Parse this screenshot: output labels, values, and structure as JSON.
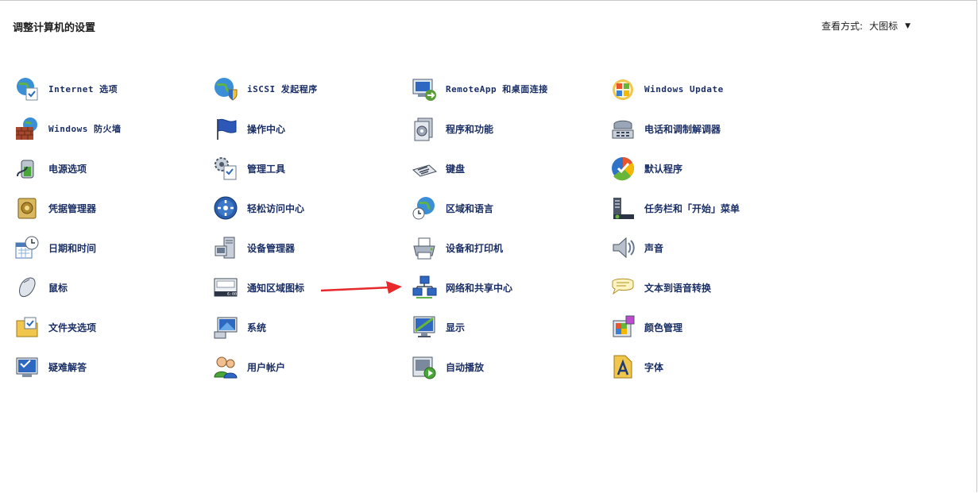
{
  "header": {
    "title": "调整计算机的设置",
    "view_label": "查看方式:",
    "view_value": "大图标"
  },
  "items": [
    {
      "label": "Internet 选项",
      "icon": "globe-check-icon"
    },
    {
      "label": "iSCSI 发起程序",
      "icon": "globe-shield-icon"
    },
    {
      "label": "RemoteApp 和桌面连接",
      "icon": "remote-desktop-icon"
    },
    {
      "label": "Windows Update",
      "icon": "windows-update-icon"
    },
    {
      "label": "Windows 防火墙",
      "icon": "firewall-icon"
    },
    {
      "label": "操作中心",
      "icon": "flag-icon"
    },
    {
      "label": "程序和功能",
      "icon": "programs-icon"
    },
    {
      "label": "电话和调制解调器",
      "icon": "phone-icon"
    },
    {
      "label": "电源选项",
      "icon": "battery-icon"
    },
    {
      "label": "管理工具",
      "icon": "admin-tools-icon"
    },
    {
      "label": "键盘",
      "icon": "keyboard-icon"
    },
    {
      "label": "默认程序",
      "icon": "default-programs-icon"
    },
    {
      "label": "凭据管理器",
      "icon": "vault-icon"
    },
    {
      "label": "轻松访问中心",
      "icon": "accessibility-icon"
    },
    {
      "label": "区域和语言",
      "icon": "globe-clock-icon"
    },
    {
      "label": "任务栏和「开始」菜单",
      "icon": "taskbar-icon"
    },
    {
      "label": "日期和时间",
      "icon": "calendar-clock-icon"
    },
    {
      "label": "设备管理器",
      "icon": "device-manager-icon"
    },
    {
      "label": "设备和打印机",
      "icon": "printer-icon"
    },
    {
      "label": "声音",
      "icon": "speaker-icon"
    },
    {
      "label": "鼠标",
      "icon": "mouse-icon"
    },
    {
      "label": "通知区域图标",
      "icon": "notification-area-icon"
    },
    {
      "label": "网络和共享中心",
      "icon": "network-icon"
    },
    {
      "label": "文本到语音转换",
      "icon": "speech-icon"
    },
    {
      "label": "文件夹选项",
      "icon": "folder-options-icon"
    },
    {
      "label": "系统",
      "icon": "system-icon"
    },
    {
      "label": "显示",
      "icon": "display-icon"
    },
    {
      "label": "颜色管理",
      "icon": "color-management-icon"
    },
    {
      "label": "疑难解答",
      "icon": "troubleshooting-icon"
    },
    {
      "label": "用户帐户",
      "icon": "users-icon"
    },
    {
      "label": "自动播放",
      "icon": "autoplay-icon"
    },
    {
      "label": "字体",
      "icon": "fonts-icon"
    }
  ],
  "colors": {
    "link": "#1a2f66",
    "annotation_arrow": "#e8282b"
  }
}
